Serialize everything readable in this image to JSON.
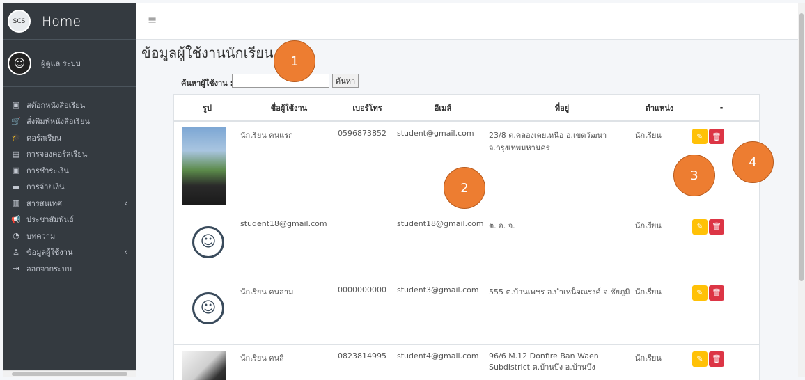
{
  "brand": {
    "title": "Home",
    "logo_text": "SCS"
  },
  "user": {
    "name": "ผู้ดูแล ระบบ",
    "avatar_glyph": "☺"
  },
  "sidebar": {
    "items": [
      {
        "label": "สต๊อกหนังสือเรียน",
        "icon": "box-icon",
        "glyph": "▣"
      },
      {
        "label": "สั่งพิมพ์หนังสือเรียน",
        "icon": "cart-icon",
        "glyph": "🛒"
      },
      {
        "label": "คอร์สเรียน",
        "icon": "graduation-cap-icon",
        "glyph": "🎓"
      },
      {
        "label": "การจองคอร์สเรียน",
        "icon": "file-icon",
        "glyph": "▤"
      },
      {
        "label": "การชำระเงิน",
        "icon": "money-icon",
        "glyph": "▣"
      },
      {
        "label": "การจ่ายเงิน",
        "icon": "credit-card-icon",
        "glyph": "▬"
      },
      {
        "label": "สารสนเทศ",
        "icon": "chart-icon",
        "glyph": "▥",
        "caret": "‹"
      },
      {
        "label": "ประชาสัมพันธ์",
        "icon": "megaphone-icon",
        "glyph": "📢"
      },
      {
        "label": "บทความ",
        "icon": "rss-icon",
        "glyph": "◔"
      },
      {
        "label": "ข้อมูลผู้ใช้งาน",
        "icon": "user-icon",
        "glyph": "♙",
        "caret": "‹"
      },
      {
        "label": "ออกจากระบบ",
        "icon": "logout-icon",
        "glyph": "⇥"
      }
    ]
  },
  "topbar": {
    "menu_glyph": "≡"
  },
  "page": {
    "title": "ข้อมูลผู้ใช้งานนักเรียน"
  },
  "search": {
    "label": "ค้นหาผู้ใช้งาน :",
    "value": "",
    "button": "ค้นหา"
  },
  "table": {
    "headers": [
      "รูป",
      "ชื่อผู้ใช้งาน",
      "เบอร์โทร",
      "อีเมล์",
      "ที่อยู่",
      "ตำแหน่ง",
      "-"
    ],
    "rows": [
      {
        "name": "นักเรียน คนแรก",
        "phone": "0596873852",
        "email": "student@gmail.com",
        "address": "23/8 ต.คลองเตยเหนือ อ.เขตวัฒนา จ.กรุงเทพมหานคร",
        "role": "นักเรียน"
      },
      {
        "name": "student18@gmail.com",
        "phone": "",
        "email": "student18@gmail.com",
        "address": "ต. อ. จ.",
        "role": "นักเรียน"
      },
      {
        "name": "นักเรียน คนสาม",
        "phone": "0000000000",
        "email": "student3@gmail.com",
        "address": "555 ต.บ้านเพชร อ.บำเหน็จณรงค์ จ.ชัยภูมิ",
        "role": "นักเรียน"
      },
      {
        "name": "นักเรียน คนสี่",
        "phone": "0823814995",
        "email": "student4@gmail.com",
        "address": "96/6 M.12 Donfire Ban Waen Subdistrict ต.บ้านบึง อ.บ้านบึง",
        "role": "นักเรียน"
      }
    ],
    "edit_glyph": "✎",
    "delete_glyph": "🗑"
  },
  "markers": [
    "1",
    "2",
    "3",
    "4"
  ],
  "colors": {
    "sidebar": "#343a40",
    "edit": "#ffc107",
    "delete": "#dc3545",
    "marker": "#ed7d31"
  }
}
